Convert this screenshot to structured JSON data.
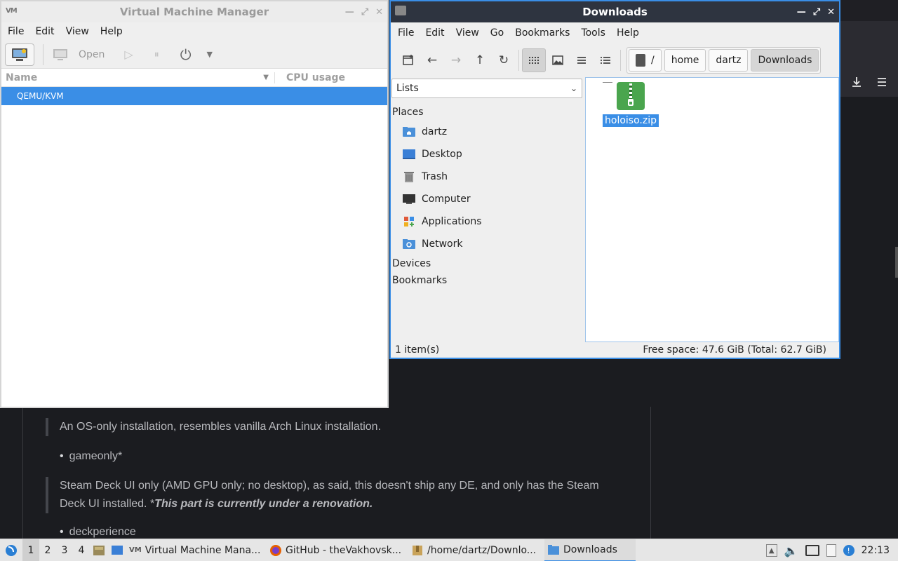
{
  "browser": {
    "download_icon": "download-icon",
    "menu_icon": "hamburger-menu-icon",
    "quote1": "An OS-only installation, resembles vanilla Arch Linux installation.",
    "bullet1": "gameonly*",
    "quote2_line1": "Steam Deck UI only (AMD GPU only; no desktop), as said, this doesn't ship any DE, and only has the Steam",
    "quote2_line2_prefix": "Deck UI installed. *",
    "quote2_emph": "This part is currently under a renovation.",
    "bullet2": "deckperience"
  },
  "vmm": {
    "title": "Virtual Machine Manager",
    "menu": [
      "File",
      "Edit",
      "View",
      "Help"
    ],
    "toolbar": {
      "open_label": "Open"
    },
    "columns": {
      "name": "Name",
      "cpu": "CPU usage"
    },
    "rows": [
      {
        "name": "QEMU/KVM"
      }
    ]
  },
  "fm": {
    "title": "Downloads",
    "menu": [
      "File",
      "Edit",
      "View",
      "Go",
      "Bookmarks",
      "Tools",
      "Help"
    ],
    "path": [
      "/",
      "home",
      "dartz",
      "Downloads"
    ],
    "side_select": "Lists",
    "sections": {
      "places": "Places",
      "devices": "Devices",
      "bookmarks": "Bookmarks"
    },
    "places": [
      {
        "label": "dartz",
        "icon": "home-folder-icon",
        "color": "#4a90d9"
      },
      {
        "label": "Desktop",
        "icon": "desktop-icon",
        "color": "#3a7fd6"
      },
      {
        "label": "Trash",
        "icon": "trash-icon",
        "color": "#888888"
      },
      {
        "label": "Computer",
        "icon": "computer-icon",
        "color": "#333333"
      },
      {
        "label": "Applications",
        "icon": "applications-icon",
        "color": "#e05a3a"
      },
      {
        "label": "Network",
        "icon": "network-folder-icon",
        "color": "#4a90d9"
      }
    ],
    "files": [
      {
        "name": "holoiso.zip",
        "icon": "zip-archive-icon",
        "selected": true
      }
    ],
    "status": {
      "count": "1 item(s)",
      "free": "Free space: 47.6 GiB (Total: 62.7 GiB)"
    }
  },
  "taskbar": {
    "workspaces": [
      "1",
      "2",
      "3",
      "4"
    ],
    "active_workspace": "1",
    "tasks": [
      {
        "label": "Virtual Machine Mana...",
        "icon": "virt-manager-icon"
      },
      {
        "label": "GitHub - theVakhovsk...",
        "icon": "firefox-icon"
      },
      {
        "label": "/home/dartz/Downlo...",
        "icon": "archive-manager-icon"
      },
      {
        "label": "Downloads",
        "icon": "folder-icon",
        "active": true
      }
    ],
    "clock": "22:13"
  },
  "colors": {
    "accent": "#3a8ee6",
    "dark_title": "#2e3440",
    "zip_green": "#4aa54e"
  }
}
